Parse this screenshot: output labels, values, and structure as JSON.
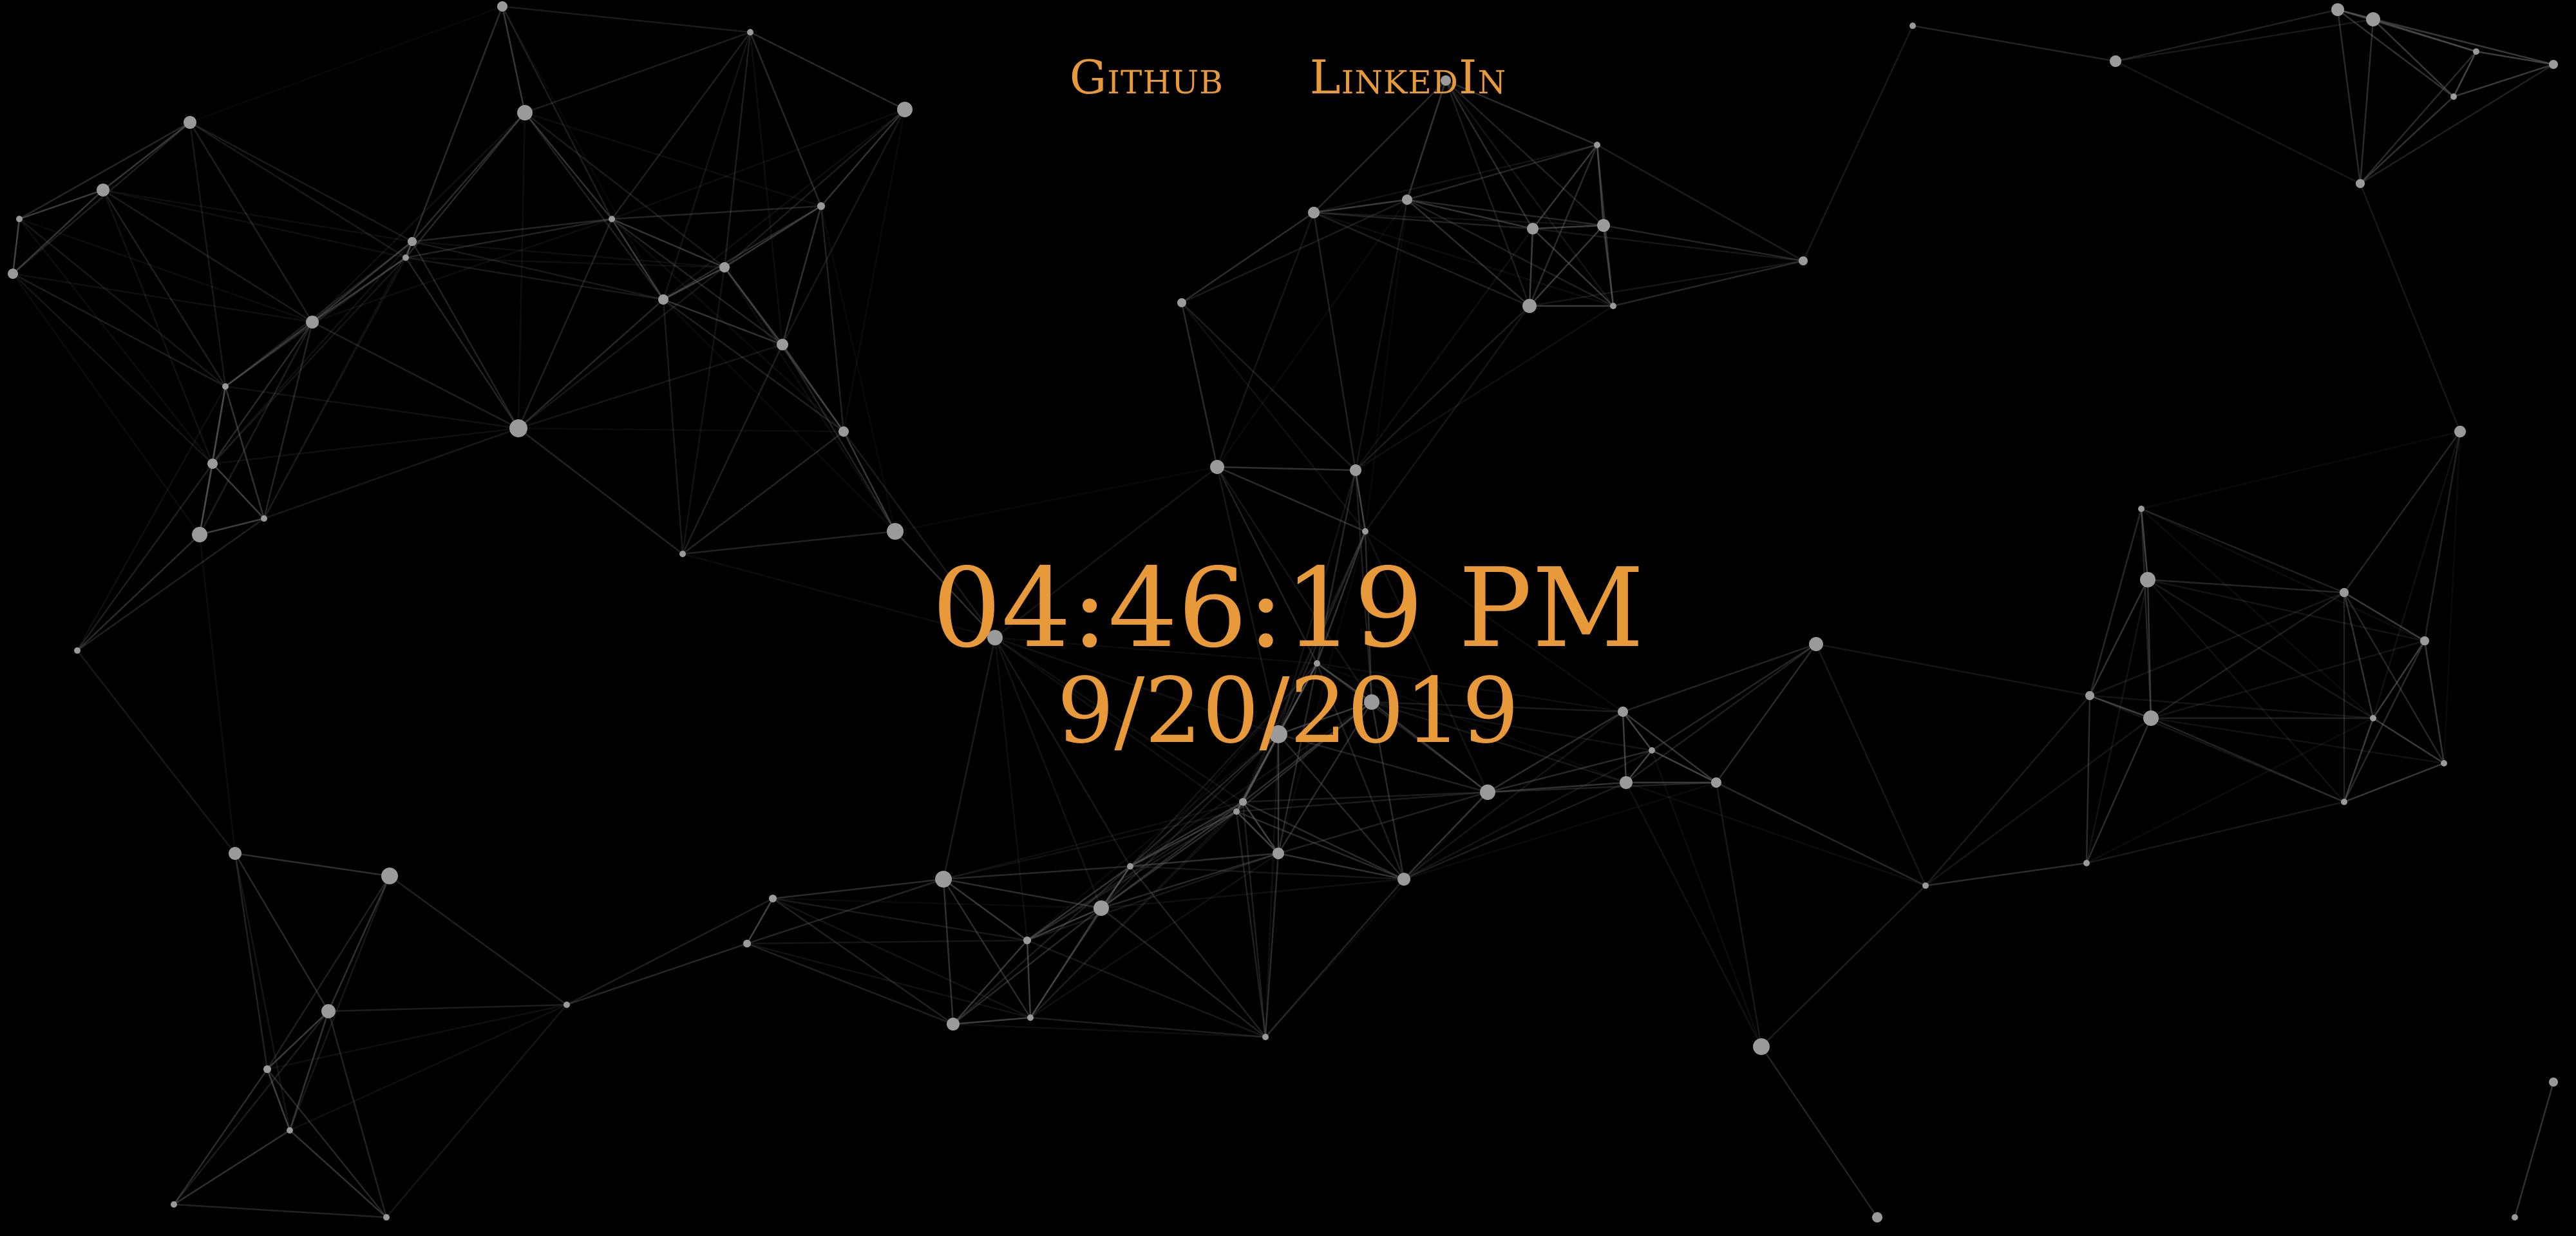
{
  "nav": {
    "links": [
      {
        "label": "Github"
      },
      {
        "label": "LinkedIn"
      }
    ]
  },
  "clock": {
    "time": "04:46:19 PM",
    "date": "9/20/2019"
  },
  "colors": {
    "background": "#000000",
    "accent": "#e8993a",
    "node": "#9a9a9a",
    "edge": "#5a5a5a"
  }
}
